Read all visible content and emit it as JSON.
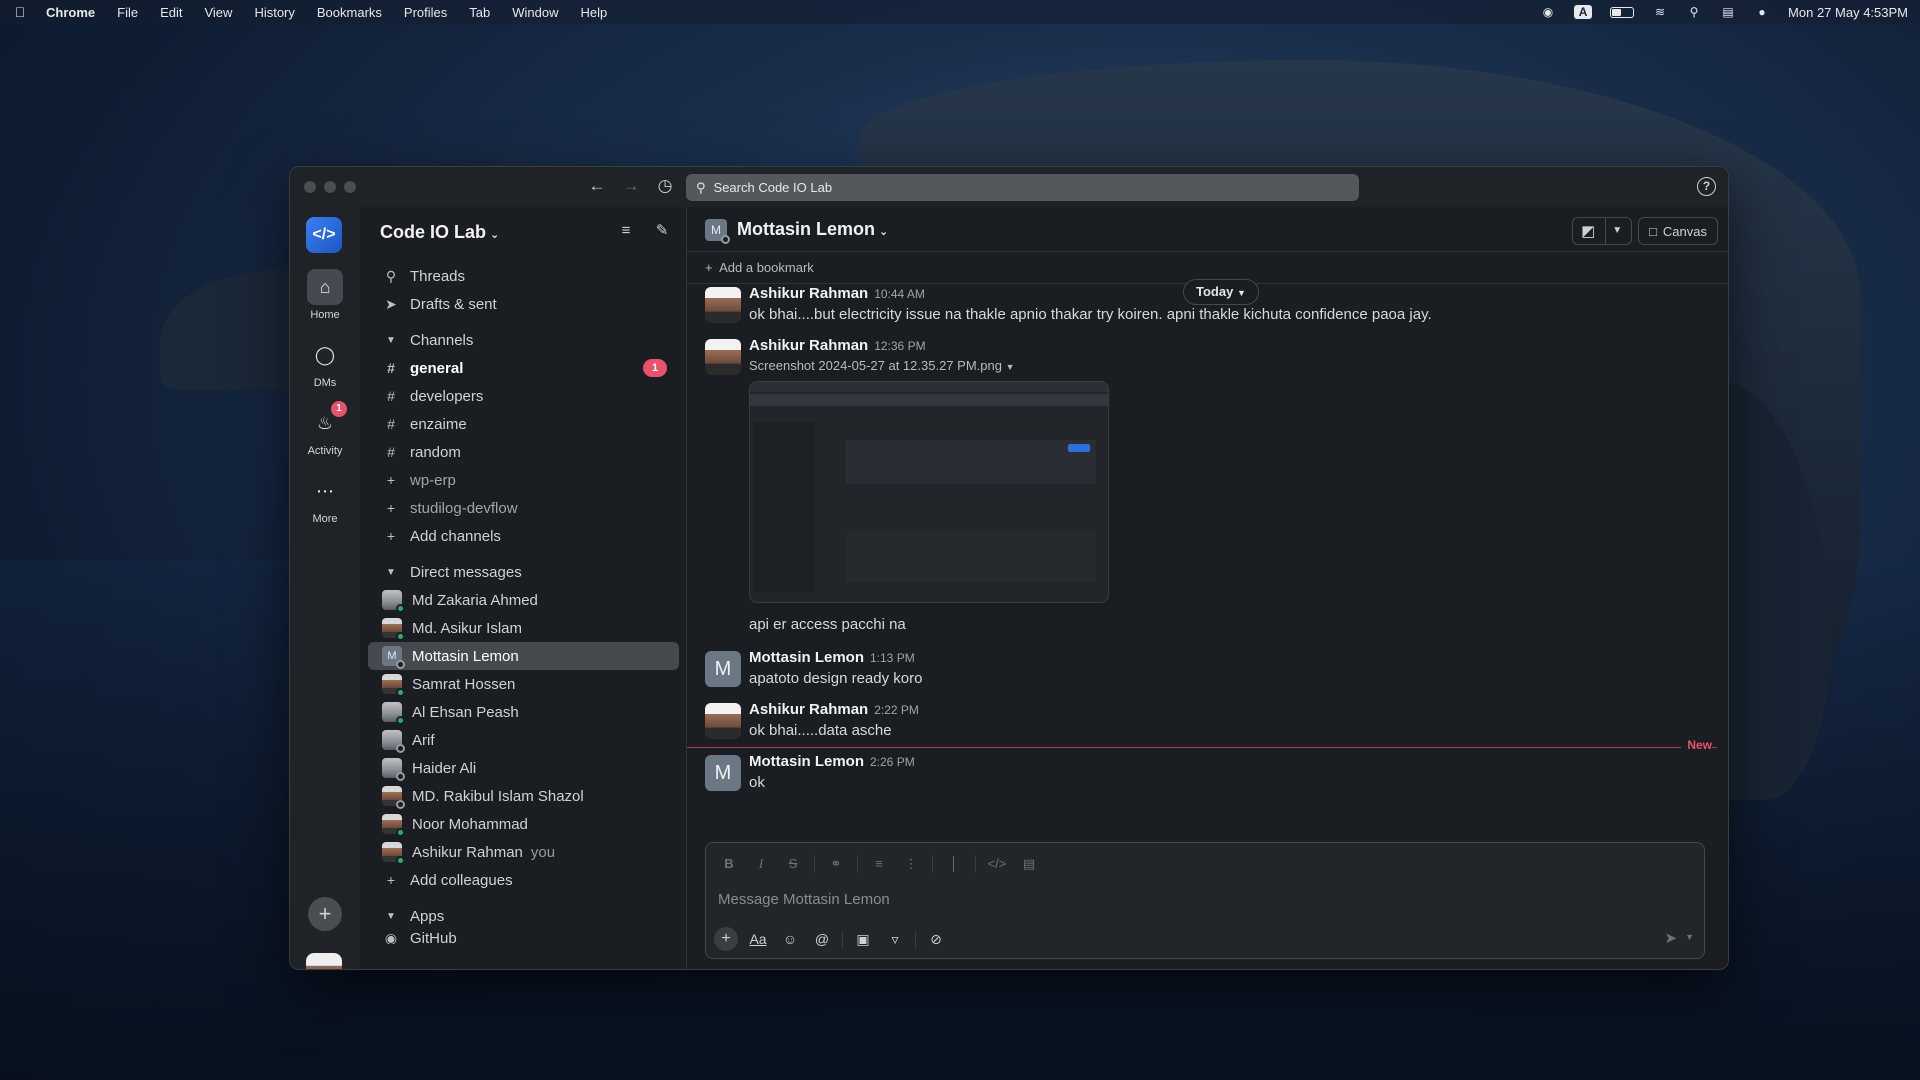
{
  "menubar": {
    "app": "Chrome",
    "items": [
      "File",
      "Edit",
      "View",
      "History",
      "Bookmarks",
      "Profiles",
      "Tab",
      "Window",
      "Help"
    ],
    "input_indicator": "A",
    "datetime": "Mon 27 May  4:53PM"
  },
  "titlebar": {
    "search_placeholder": "Search Code IO Lab"
  },
  "rail": {
    "items": [
      {
        "label": "Home"
      },
      {
        "label": "DMs"
      },
      {
        "label": "Activity",
        "badge": "1"
      },
      {
        "label": "More"
      }
    ]
  },
  "sidebar": {
    "workspace": "Code IO Lab",
    "threads": "Threads",
    "drafts": "Drafts & sent",
    "channels_header": "Channels",
    "channels": [
      {
        "name": "general",
        "badge": "1",
        "unread": true
      },
      {
        "name": "developers"
      },
      {
        "name": "enzaime"
      },
      {
        "name": "random"
      },
      {
        "name": "wp-erp",
        "joinable": true
      },
      {
        "name": "studilog-devflow",
        "joinable": true
      }
    ],
    "add_channels": "Add channels",
    "dms_header": "Direct messages",
    "dms": [
      {
        "name": "Md Zakaria Ahmed"
      },
      {
        "name": "Md. Asikur Islam"
      },
      {
        "name": "Mottasin Lemon",
        "initial": "M",
        "active": true
      },
      {
        "name": "Samrat Hossen"
      },
      {
        "name": "Al Ehsan Peash"
      },
      {
        "name": "Arif"
      },
      {
        "name": "Haider Ali"
      },
      {
        "name": "MD. Rakibul Islam Shazol"
      },
      {
        "name": "Noor Mohammad"
      },
      {
        "name": "Ashikur Rahman",
        "suffix": "you"
      }
    ],
    "add_colleagues": "Add colleagues",
    "apps_header": "Apps",
    "apps_first_partial": "GitHub"
  },
  "channel": {
    "title": "Mottasin Lemon",
    "avatar_initial": "M",
    "canvas_label": "Canvas",
    "add_bookmark": "Add a bookmark",
    "today_label": "Today"
  },
  "messages": [
    {
      "author": "Ashikur Rahman",
      "time": "10:44 AM",
      "text": "ok bhai....but electricity issue na thakle apnio thakar try koiren. apni thakle kichuta confidence paoa jay."
    },
    {
      "author": "Ashikur Rahman",
      "time": "12:36 PM",
      "file": "Screenshot 2024-05-27 at 12.35.27 PM.png",
      "text": "api er access pacchi na"
    },
    {
      "author": "Mottasin Lemon",
      "time": "1:13 PM",
      "text": "apatoto design ready koro",
      "initial": "M"
    },
    {
      "author": "Ashikur Rahman",
      "time": "2:22 PM",
      "text": "ok bhai.....data asche"
    },
    {
      "author": "Mottasin Lemon",
      "time": "2:26 PM",
      "text": "ok",
      "initial": "M"
    }
  ],
  "new_label": "New",
  "composer": {
    "placeholder": "Message Mottasin Lemon",
    "aa_label": "Aa"
  }
}
